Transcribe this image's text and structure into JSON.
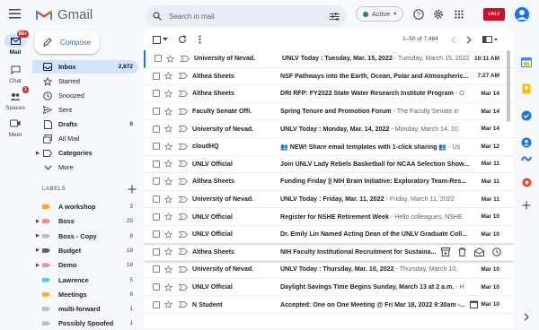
{
  "app": {
    "name": "Gmail"
  },
  "rail": {
    "mail_label": "Mail",
    "mail_badge": "99+",
    "chat_label": "Chat",
    "spaces_label": "Spaces",
    "spaces_badge": "1",
    "meet_label": "Meet"
  },
  "search": {
    "placeholder": "Search in mail"
  },
  "status": {
    "label": "Active"
  },
  "compose": {
    "label": "Compose"
  },
  "nav": [
    {
      "label": "Inbox",
      "count": "2,872"
    },
    {
      "label": "Starred",
      "count": ""
    },
    {
      "label": "Snoozed",
      "count": ""
    },
    {
      "label": "Sent",
      "count": ""
    },
    {
      "label": "Drafts",
      "count": "8"
    },
    {
      "label": "All Mail",
      "count": ""
    },
    {
      "label": "Categories",
      "count": ""
    },
    {
      "label": "More",
      "count": ""
    }
  ],
  "labels_header": "LABELS",
  "labels": [
    {
      "name": "A workshop",
      "count": "3",
      "color": "#f9a825"
    },
    {
      "name": "Boss",
      "count": "25",
      "color": "#f28b82"
    },
    {
      "name": "Boss - Copy",
      "count": "8",
      "color": "#bdc1c6"
    },
    {
      "name": "Budget",
      "count": "18",
      "color": "#5f6368"
    },
    {
      "name": "Demo",
      "count": "18",
      "color": "#f48fb1"
    },
    {
      "name": "Lawrence",
      "count": "5",
      "color": "#4ecde6"
    },
    {
      "name": "Meetings",
      "count": "8",
      "color": "#f6ae2d"
    },
    {
      "name": "multi-forward",
      "count": "1",
      "color": "#bdc1c6"
    },
    {
      "name": "Possibly Spoofed",
      "count": "1",
      "color": "#bdc1c6"
    }
  ],
  "toolbar": {
    "range": "1–50 of 7,484"
  },
  "emails": [
    {
      "sender": "University of Nevad.",
      "subject": "UNLV Today : Tuesday, Mar. 15, 2022",
      "snippet": " - Tuesday, March 15, 2022",
      "date": "10:11 AM",
      "unread": true
    },
    {
      "sender": "Althea Sheets",
      "subject": "NSF Pathways into the Earth, Ocean, Polar and Atmospheric...",
      "snippet": "",
      "date": "7:27 AM",
      "unread": true
    },
    {
      "sender": "Althea Sheets",
      "subject": "DRI RFP: FY2022 State Water Research Institute Program",
      "snippet": " - O",
      "date": "Mar 14",
      "unread": true
    },
    {
      "sender": "Faculty Senate Offi.",
      "subject": "Spring Tenure and Promotion Forum",
      "snippet": " - The Faculty Senate in",
      "date": "Mar 14",
      "unread": true
    },
    {
      "sender": "University of Nevad.",
      "subject": "UNLV Today : Monday, Mar. 14, 2022",
      "snippet": " - Monday, March 14, 20",
      "date": "Mar 14",
      "unread": true
    },
    {
      "sender": "cloudHQ",
      "subject": "👥 NEW! Share email templates with 1-click sharing 👥",
      "snippet": " - Us",
      "date": "Mar 12",
      "unread": true
    },
    {
      "sender": "UNLV Official",
      "subject": "Join UNLV Lady Rebels Basketball for NCAA Selection Show...",
      "snippet": "",
      "date": "Mar 11",
      "unread": true
    },
    {
      "sender": "Althea Sheets",
      "subject": "Funding Friday || NIH Brain Initiative: Exploratory Team-Res...",
      "snippet": "",
      "date": "Mar 11",
      "unread": true
    },
    {
      "sender": "University of Nevad.",
      "subject": "UNLV Today : Friday, Mar. 11, 2022",
      "snippet": " - Friday, March 11, 2022",
      "date": "Mar 11",
      "unread": true
    },
    {
      "sender": "UNLV Official",
      "subject": "Register for NSHE Retirement Week",
      "snippet": " - Hello colleagues, NSHE",
      "date": "Mar 10",
      "unread": true
    },
    {
      "sender": "UNLV Official",
      "subject": "Dr. Emily Lin Named Acting Dean of the UNLV Graduate Coll...",
      "snippet": "",
      "date": "Mar 10",
      "unread": true
    },
    {
      "sender": "Althea Sheets",
      "subject": "NIH Faculty Institutional Recruitment for Sustaina...",
      "snippet": "",
      "date": "",
      "unread": true,
      "hover": true
    },
    {
      "sender": "University of Nevad.",
      "subject": "UNLV Today : Thursday, Mar. 10, 2022",
      "snippet": " - Thursday, March 10,",
      "date": "Mar 10",
      "unread": true
    },
    {
      "sender": "UNLV Official",
      "subject": "Daylight Savings Time Begins Sunday, March 13 at 2 a.m.",
      "snippet": " - H",
      "date": "Mar 10",
      "unread": true
    },
    {
      "sender": "N Student",
      "subject": "Accepted: One on One Meeting @ Fri Mar 18, 2022 9:30am -...",
      "snippet": "",
      "date": "Mar 10",
      "unread": true,
      "calendar": true
    }
  ],
  "logo_badge": "UNLV"
}
